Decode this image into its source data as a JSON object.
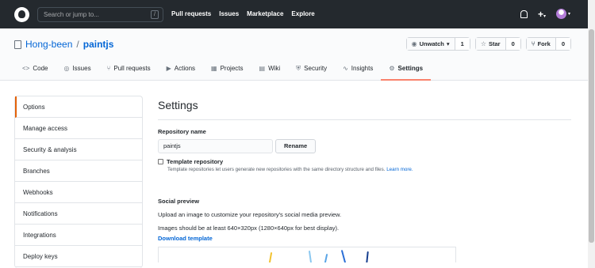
{
  "topbar": {
    "search_placeholder": "Search or jump to...",
    "search_key": "/",
    "nav": [
      "Pull requests",
      "Issues",
      "Marketplace",
      "Explore"
    ],
    "icons": [
      "github-logo",
      "bell-icon",
      "plus-icon",
      "avatar"
    ]
  },
  "repo": {
    "owner": "Hong-been",
    "separator": "/",
    "name": "paintjs",
    "unwatch_label": "Unwatch",
    "unwatch_count": "1",
    "star_label": "Star",
    "star_count": "0",
    "fork_label": "Fork",
    "fork_count": "0"
  },
  "tabs": [
    {
      "label": "Code",
      "icon": "<>"
    },
    {
      "label": "Issues",
      "icon": "◎"
    },
    {
      "label": "Pull requests",
      "icon": "⑂"
    },
    {
      "label": "Actions",
      "icon": "▶"
    },
    {
      "label": "Projects",
      "icon": "▦"
    },
    {
      "label": "Wiki",
      "icon": "▤"
    },
    {
      "label": "Security",
      "icon": "⛨"
    },
    {
      "label": "Insights",
      "icon": "∿"
    },
    {
      "label": "Settings",
      "icon": "⚙"
    }
  ],
  "sidebar": {
    "items": [
      "Options",
      "Manage access",
      "Security & analysis",
      "Branches",
      "Webhooks",
      "Notifications",
      "Integrations",
      "Deploy keys"
    ]
  },
  "settings": {
    "title": "Settings",
    "repo_name_label": "Repository name",
    "repo_name_value": "paintjs",
    "rename_label": "Rename",
    "template_label": "Template repository",
    "template_note": "Template repositories let users generate new repositories with the same directory structure and files.",
    "learn_more": "Learn more.",
    "social_title": "Social preview",
    "social_desc": "Upload an image to customize your repository's social media preview.",
    "social_size": "Images should be at least 640×320px (1280×640px for best display).",
    "download_template": "Download template"
  },
  "colors": {
    "topbar_bg": "#24292e",
    "link": "#0366d6",
    "active_tab_underline": "#f9826c",
    "active_side_border": "#e36209"
  }
}
